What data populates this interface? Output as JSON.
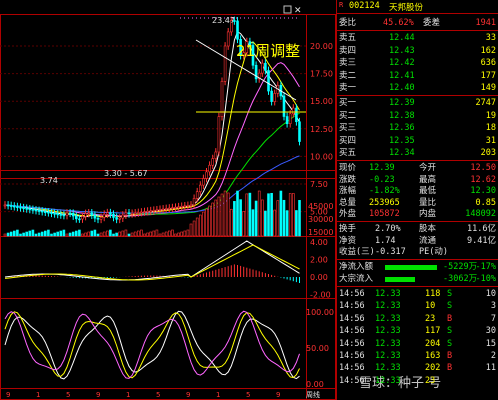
{
  "header": {
    "mark": "R",
    "code": "002124",
    "name": "天邦股份"
  },
  "chart": {
    "annotation": "21周调整",
    "high_label": "23.47",
    "low_label": "3.74",
    "range_label": "3.30 - 5.67",
    "price_axis": [
      "20.00",
      "17.50",
      "15.00",
      "12.50",
      "10.00",
      "7.50",
      "5.00"
    ],
    "vol_axis": [
      "45000",
      "30000",
      "15000"
    ],
    "macd_axis": [
      "4.00",
      "2.00",
      "0.00",
      "-2.00"
    ],
    "kdj_axis": [
      "100.00",
      "50.00",
      "0.00"
    ],
    "x_labels": [
      "9",
      "1",
      "5",
      "9",
      "1",
      "5",
      "9",
      "1",
      "5",
      "9",
      "周线"
    ]
  },
  "orderbook": {
    "ratio": {
      "label": "委比",
      "ratio": "45.62%",
      "diff_label": "委差",
      "diff": "1941"
    },
    "asks": [
      {
        "label": "卖五",
        "price": "12.44",
        "vol": "33"
      },
      {
        "label": "卖四",
        "price": "12.43",
        "vol": "162"
      },
      {
        "label": "卖三",
        "price": "12.42",
        "vol": "636"
      },
      {
        "label": "卖二",
        "price": "12.41",
        "vol": "177"
      },
      {
        "label": "卖一",
        "price": "12.40",
        "vol": "149"
      }
    ],
    "bids": [
      {
        "label": "买一",
        "price": "12.39",
        "vol": "2747"
      },
      {
        "label": "买二",
        "price": "12.38",
        "vol": "19"
      },
      {
        "label": "买三",
        "price": "12.36",
        "vol": "18"
      },
      {
        "label": "买四",
        "price": "12.35",
        "vol": "31"
      },
      {
        "label": "买五",
        "price": "12.34",
        "vol": "203"
      }
    ]
  },
  "quote": [
    {
      "l1": "现价",
      "v1": "12.39",
      "l2": "今开",
      "v2": "12.50"
    },
    {
      "l1": "涨跌",
      "v1": "-0.23",
      "l2": "最高",
      "v2": "12.62"
    },
    {
      "l1": "涨幅",
      "v1": "-1.82%",
      "l2": "最低",
      "v2": "12.30"
    },
    {
      "l1": "总量",
      "v1": "253965",
      "l2": "量比",
      "v2": "0.85"
    },
    {
      "l1": "外盘",
      "v1": "105872",
      "l2": "内盘",
      "v2": "148092"
    }
  ],
  "fund": [
    {
      "l1": "换手",
      "v1": "2.70%",
      "l2": "股本",
      "v2": "11.6亿"
    },
    {
      "l1": "净资",
      "v1": "1.74",
      "l2": "流通",
      "v2": "9.41亿"
    },
    {
      "l1": "收益(三)",
      "v1": "-0.317",
      "l2": "PE(动)",
      "v2": ""
    }
  ],
  "flows": [
    {
      "label": "净流入额",
      "amount": "-5229万",
      "pct": "-17%"
    },
    {
      "label": "大宗流入",
      "amount": "-3062万",
      "pct": "-10%"
    }
  ],
  "ticks": [
    {
      "time": "14:56",
      "price": "12.33",
      "vol": "118",
      "dir": "S",
      "n": "10"
    },
    {
      "time": "14:56",
      "price": "12.33",
      "vol": "10",
      "dir": "S",
      "n": "3"
    },
    {
      "time": "14:56",
      "price": "12.33",
      "vol": "23",
      "dir": "B",
      "n": "7"
    },
    {
      "time": "14:56",
      "price": "12.33",
      "vol": "117",
      "dir": "S",
      "n": "30"
    },
    {
      "time": "14:56",
      "price": "12.33",
      "vol": "204",
      "dir": "S",
      "n": "15"
    },
    {
      "time": "14:56",
      "price": "12.33",
      "vol": "163",
      "dir": "B",
      "n": "2"
    },
    {
      "time": "14:56",
      "price": "12.33",
      "vol": "202",
      "dir": "B",
      "n": "11"
    },
    {
      "time": "14:56",
      "price": "12.33",
      "vol": "23",
      "dir": "",
      "n": ""
    }
  ],
  "watermark": "雪球：种子 号",
  "colors": {
    "up": "#ff3232",
    "down": "#00ffff",
    "flat": "#ffff00",
    "frame": "#b00000",
    "ma5": "#ffffff",
    "ma10": "#ffff00",
    "ma20": "#ff66ff",
    "ma60": "#00e000",
    "ma120": "#3a5aff"
  }
}
